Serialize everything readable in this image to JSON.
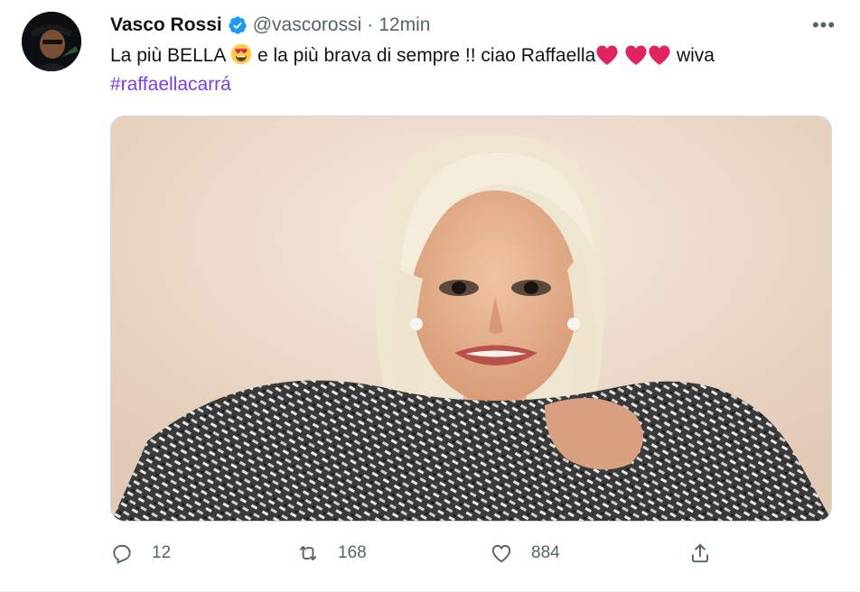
{
  "tweet": {
    "author_name": "Vasco Rossi",
    "handle": "@vascorossi",
    "separator": "·",
    "time": "12min",
    "more_label": "•••",
    "text_part1": "La più BELLA ",
    "text_part2": " e la più brava di sempre !! ciao Raffaella",
    "text_part3": " wiva",
    "hashtag": "#raffaellacarrá",
    "media_icon": "photo-of-woman-in-feather-boa"
  },
  "actions": {
    "reply_count": "12",
    "retweet_count": "168",
    "like_count": "884"
  },
  "colors": {
    "verified": "#1d9bf0",
    "hashtag": "#7b3fe4",
    "meta_gray": "#536471",
    "heart_red": "#e0245e"
  }
}
